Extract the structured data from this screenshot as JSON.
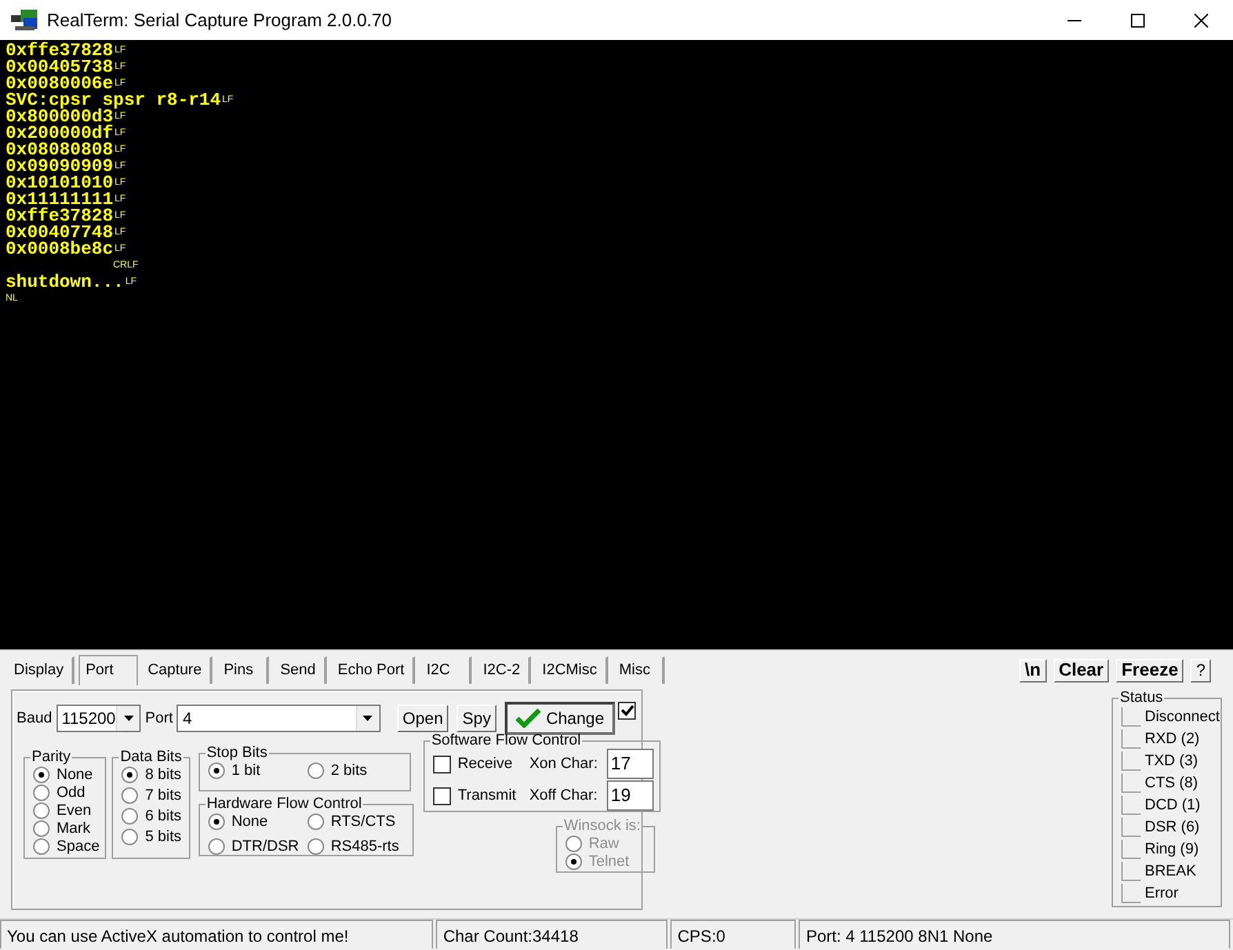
{
  "window": {
    "title": "RealTerm: Serial Capture Program 2.0.0.70"
  },
  "terminal": {
    "lines": [
      {
        "kind": "text",
        "text": "0xffe37828",
        "marker": "LF"
      },
      {
        "kind": "text",
        "text": "0x00405738",
        "marker": "LF"
      },
      {
        "kind": "text",
        "text": "0x0080006e",
        "marker": "LF"
      },
      {
        "kind": "text",
        "text": "SVC:cpsr spsr r8-r14",
        "marker": "LF"
      },
      {
        "kind": "text",
        "text": "0x800000d3",
        "marker": "LF"
      },
      {
        "kind": "text",
        "text": "0x200000df",
        "marker": "LF"
      },
      {
        "kind": "text",
        "text": "0x08080808",
        "marker": "LF"
      },
      {
        "kind": "text",
        "text": "0x09090909",
        "marker": "LF"
      },
      {
        "kind": "text",
        "text": "0x10101010",
        "marker": "LF"
      },
      {
        "kind": "text",
        "text": "0x11111111",
        "marker": "LF"
      },
      {
        "kind": "text",
        "text": "0xffe37828",
        "marker": "LF"
      },
      {
        "kind": "text",
        "text": "0x00407748",
        "marker": "LF"
      },
      {
        "kind": "text",
        "text": "0x0008be8c",
        "marker": "LF"
      },
      {
        "kind": "trailing",
        "marker": "CRLF"
      },
      {
        "kind": "text",
        "text": "shutdown...",
        "marker": "LF"
      },
      {
        "kind": "marker_only",
        "marker": "NL"
      }
    ]
  },
  "tabs": [
    {
      "label": "Display",
      "selected": false
    },
    {
      "label": "Port",
      "selected": true
    },
    {
      "label": "Capture",
      "selected": false
    },
    {
      "label": "Pins",
      "selected": false
    },
    {
      "label": "Send",
      "selected": false
    },
    {
      "label": "Echo Port",
      "selected": false
    },
    {
      "label": "I2C",
      "selected": false
    },
    {
      "label": "I2C-2",
      "selected": false
    },
    {
      "label": "I2CMisc",
      "selected": false
    },
    {
      "label": "Misc",
      "selected": false
    }
  ],
  "toolbar_buttons": [
    {
      "label": "\\n",
      "bold": true
    },
    {
      "label": "Clear",
      "bold": true
    },
    {
      "label": "Freeze",
      "bold": true
    },
    {
      "label": "?",
      "bold": false
    }
  ],
  "port": {
    "baud_label": "Baud",
    "baud": "115200",
    "port_label": "Port",
    "port": "4",
    "buttons": [
      {
        "label": "Open",
        "kind": "flat"
      },
      {
        "label": "Spy",
        "kind": "flat"
      },
      {
        "label": "Change",
        "kind": "default"
      }
    ],
    "change_checked": true,
    "parity": {
      "title": "Parity",
      "options": [
        {
          "label": "None",
          "selected": true
        },
        {
          "label": "Odd",
          "selected": false
        },
        {
          "label": "Even",
          "selected": false
        },
        {
          "label": "Mark",
          "selected": false
        },
        {
          "label": "Space",
          "selected": false
        }
      ]
    },
    "data_bits": {
      "title": "Data Bits",
      "options": [
        {
          "label": "8 bits",
          "selected": true
        },
        {
          "label": "7 bits",
          "selected": false
        },
        {
          "label": "6 bits",
          "selected": false
        },
        {
          "label": "5 bits",
          "selected": false
        }
      ]
    },
    "stop_bits": {
      "title": "Stop Bits",
      "options": [
        {
          "label": "1 bit",
          "selected": true
        },
        {
          "label": "2 bits",
          "selected": false
        }
      ]
    },
    "hardware_flow": {
      "title": "Hardware Flow Control",
      "options": [
        {
          "label": "None",
          "selected": true
        },
        {
          "label": "RTS/CTS",
          "selected": false
        },
        {
          "label": "DTR/DSR",
          "selected": false
        },
        {
          "label": "RS485-rts",
          "selected": false
        }
      ]
    },
    "software_flow": {
      "title": "Software Flow Control",
      "rows": [
        {
          "label": "Receive",
          "checked": false,
          "char_label": "Xon Char:",
          "value": "17"
        },
        {
          "label": "Transmit",
          "checked": false,
          "char_label": "Xoff Char:",
          "value": "19"
        }
      ]
    },
    "winsock": {
      "title": "Winsock is:",
      "disabled": true,
      "options": [
        {
          "label": "Raw",
          "selected": false
        },
        {
          "label": "Telnet",
          "selected": true
        }
      ]
    }
  },
  "status": {
    "title": "Status",
    "items": [
      {
        "label": "Disconnect",
        "lit": false
      },
      {
        "label": "RXD (2)",
        "lit": false
      },
      {
        "label": "TXD (3)",
        "lit": false
      },
      {
        "label": "CTS (8)",
        "lit": false
      },
      {
        "label": "DCD (1)",
        "lit": false
      },
      {
        "label": "DSR (6)",
        "lit": false
      },
      {
        "label": "Ring (9)",
        "lit": false
      },
      {
        "label": "BREAK",
        "lit": false
      },
      {
        "label": "Error",
        "lit": false
      }
    ]
  },
  "status_bar": [
    "You can use ActiveX automation to control me!",
    "Char Count:34418",
    "CPS:0",
    "Port: 4 115200 8N1 None"
  ]
}
